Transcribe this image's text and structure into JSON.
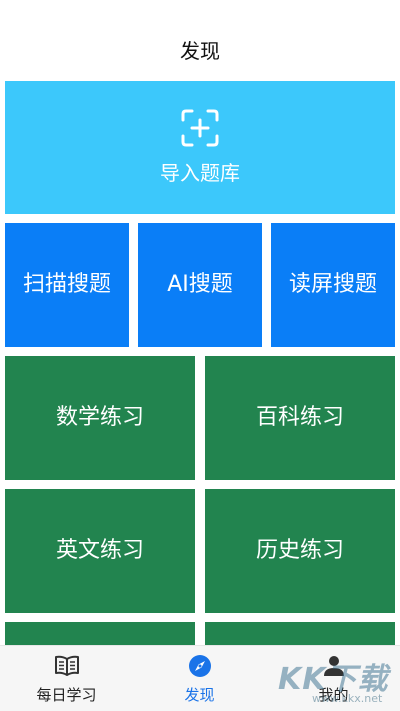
{
  "header": {
    "title": "发现"
  },
  "import_tile": {
    "label": "导入题库",
    "icon": "scan-plus-icon",
    "color": "#3cc8fb"
  },
  "search_row": {
    "color": "#0a7ef7",
    "items": [
      {
        "label": "扫描搜题"
      },
      {
        "label": "AI搜题"
      },
      {
        "label": "读屏搜题"
      }
    ]
  },
  "practice": {
    "color": "#22844f",
    "items": [
      {
        "label": "数学练习"
      },
      {
        "label": "百科练习"
      },
      {
        "label": "英文练习"
      },
      {
        "label": "历史练习"
      }
    ]
  },
  "tabbar": {
    "active_color": "#1a73e8",
    "tabs": [
      {
        "label": "每日学习",
        "icon": "book-icon"
      },
      {
        "label": "发现",
        "icon": "compass-icon",
        "active": true
      },
      {
        "label": "我的",
        "icon": "person-icon"
      }
    ]
  },
  "watermark": {
    "text": "KK下载",
    "url": "www.kkx.net"
  }
}
